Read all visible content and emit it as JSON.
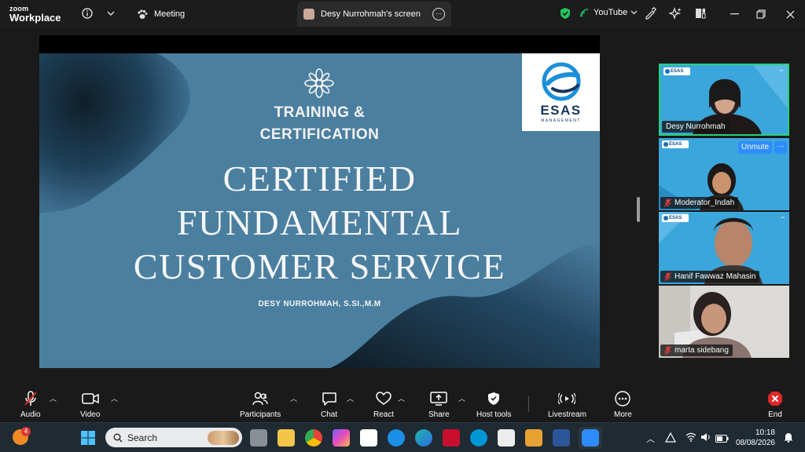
{
  "app": {
    "brand_line1": "zoom",
    "brand_line2": "Workplace"
  },
  "titlebar": {
    "meeting_label": "Meeting",
    "screen_tab_label": "Desy Nurrohmah's screen",
    "livestream_target": "YouTube"
  },
  "slide": {
    "subtitle_line1": "TRAINING &",
    "subtitle_line2": "CERTIFICATION",
    "title_line1": "CERTIFIED",
    "title_line2": "FUNDAMENTAL",
    "title_line3": "CUSTOMER SERVICE",
    "author": "DESY NURROHMAH, S.SI.,M.M",
    "logo_text": "ESAS",
    "logo_subtext": "MANAGEMENT"
  },
  "participants": [
    {
      "name": "Desy Nurrohmah",
      "muted": false,
      "active_speaker": true
    },
    {
      "name": "Moderator_Indah",
      "muted": true,
      "unmute_label": "Unmute"
    },
    {
      "name": "Hanif Fawwaz Mahasin",
      "muted": true
    },
    {
      "name": "marta sidebang",
      "muted": true
    }
  ],
  "toolbar": {
    "audio": "Audio",
    "video": "Video",
    "participants": "Participants",
    "participants_count": "4",
    "chat": "Chat",
    "react": "React",
    "share": "Share",
    "host_tools": "Host tools",
    "livestream": "Livestream",
    "more": "More",
    "end": "End"
  },
  "taskbar": {
    "search_placeholder": "Search",
    "notification_count": "4",
    "time": "10:18",
    "date": "08/08/2026"
  },
  "colors": {
    "slide_bg": "#4b7fa0",
    "zoom_blue": "#2d8cff",
    "active_border": "#27d07a",
    "end_red": "#e02828"
  }
}
